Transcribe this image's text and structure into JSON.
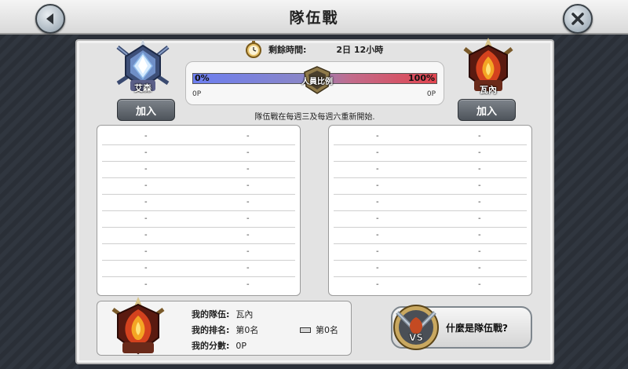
{
  "title": "隊伍戰",
  "timer": {
    "label": "剩餘時間:",
    "value": "2日 12小時"
  },
  "teams": {
    "left": {
      "name": "艾森",
      "join_label": "加入"
    },
    "right": {
      "name": "瓦內",
      "join_label": "加入"
    }
  },
  "ratio": {
    "left_percent": "0%",
    "right_percent": "100%",
    "center_label": "人員比例",
    "left_score": "0P",
    "right_score": "0P",
    "left_fraction": 0.0
  },
  "notice": "隊伍戰在每週三及每週六重新開始.",
  "lists": {
    "left": [
      {
        "a": "-",
        "b": "-"
      },
      {
        "a": "-",
        "b": "-"
      },
      {
        "a": "-",
        "b": "-"
      },
      {
        "a": "-",
        "b": "-"
      },
      {
        "a": "-",
        "b": "-"
      },
      {
        "a": "-",
        "b": "-"
      },
      {
        "a": "-",
        "b": "-"
      },
      {
        "a": "-",
        "b": "-"
      },
      {
        "a": "-",
        "b": "-"
      },
      {
        "a": "-",
        "b": "-"
      }
    ],
    "right": [
      {
        "a": "-",
        "b": "-"
      },
      {
        "a": "-",
        "b": "-"
      },
      {
        "a": "-",
        "b": "-"
      },
      {
        "a": "-",
        "b": "-"
      },
      {
        "a": "-",
        "b": "-"
      },
      {
        "a": "-",
        "b": "-"
      },
      {
        "a": "-",
        "b": "-"
      },
      {
        "a": "-",
        "b": "-"
      },
      {
        "a": "-",
        "b": "-"
      },
      {
        "a": "-",
        "b": "-"
      }
    ]
  },
  "my_team": {
    "team_label": "我的隊伍:",
    "team_value": "瓦內",
    "rank_label": "我的排名:",
    "rank_value": "第0名",
    "score_label": "我的分數:",
    "score_value": "0P",
    "rank_change": "第0名"
  },
  "what_is_label": "什麼是隊伍戰?",
  "vs_label": "VS",
  "colors": {
    "bar_left": "#6c7ef0",
    "bar_right": "#e2454f",
    "panel": "#e3e3e3"
  }
}
